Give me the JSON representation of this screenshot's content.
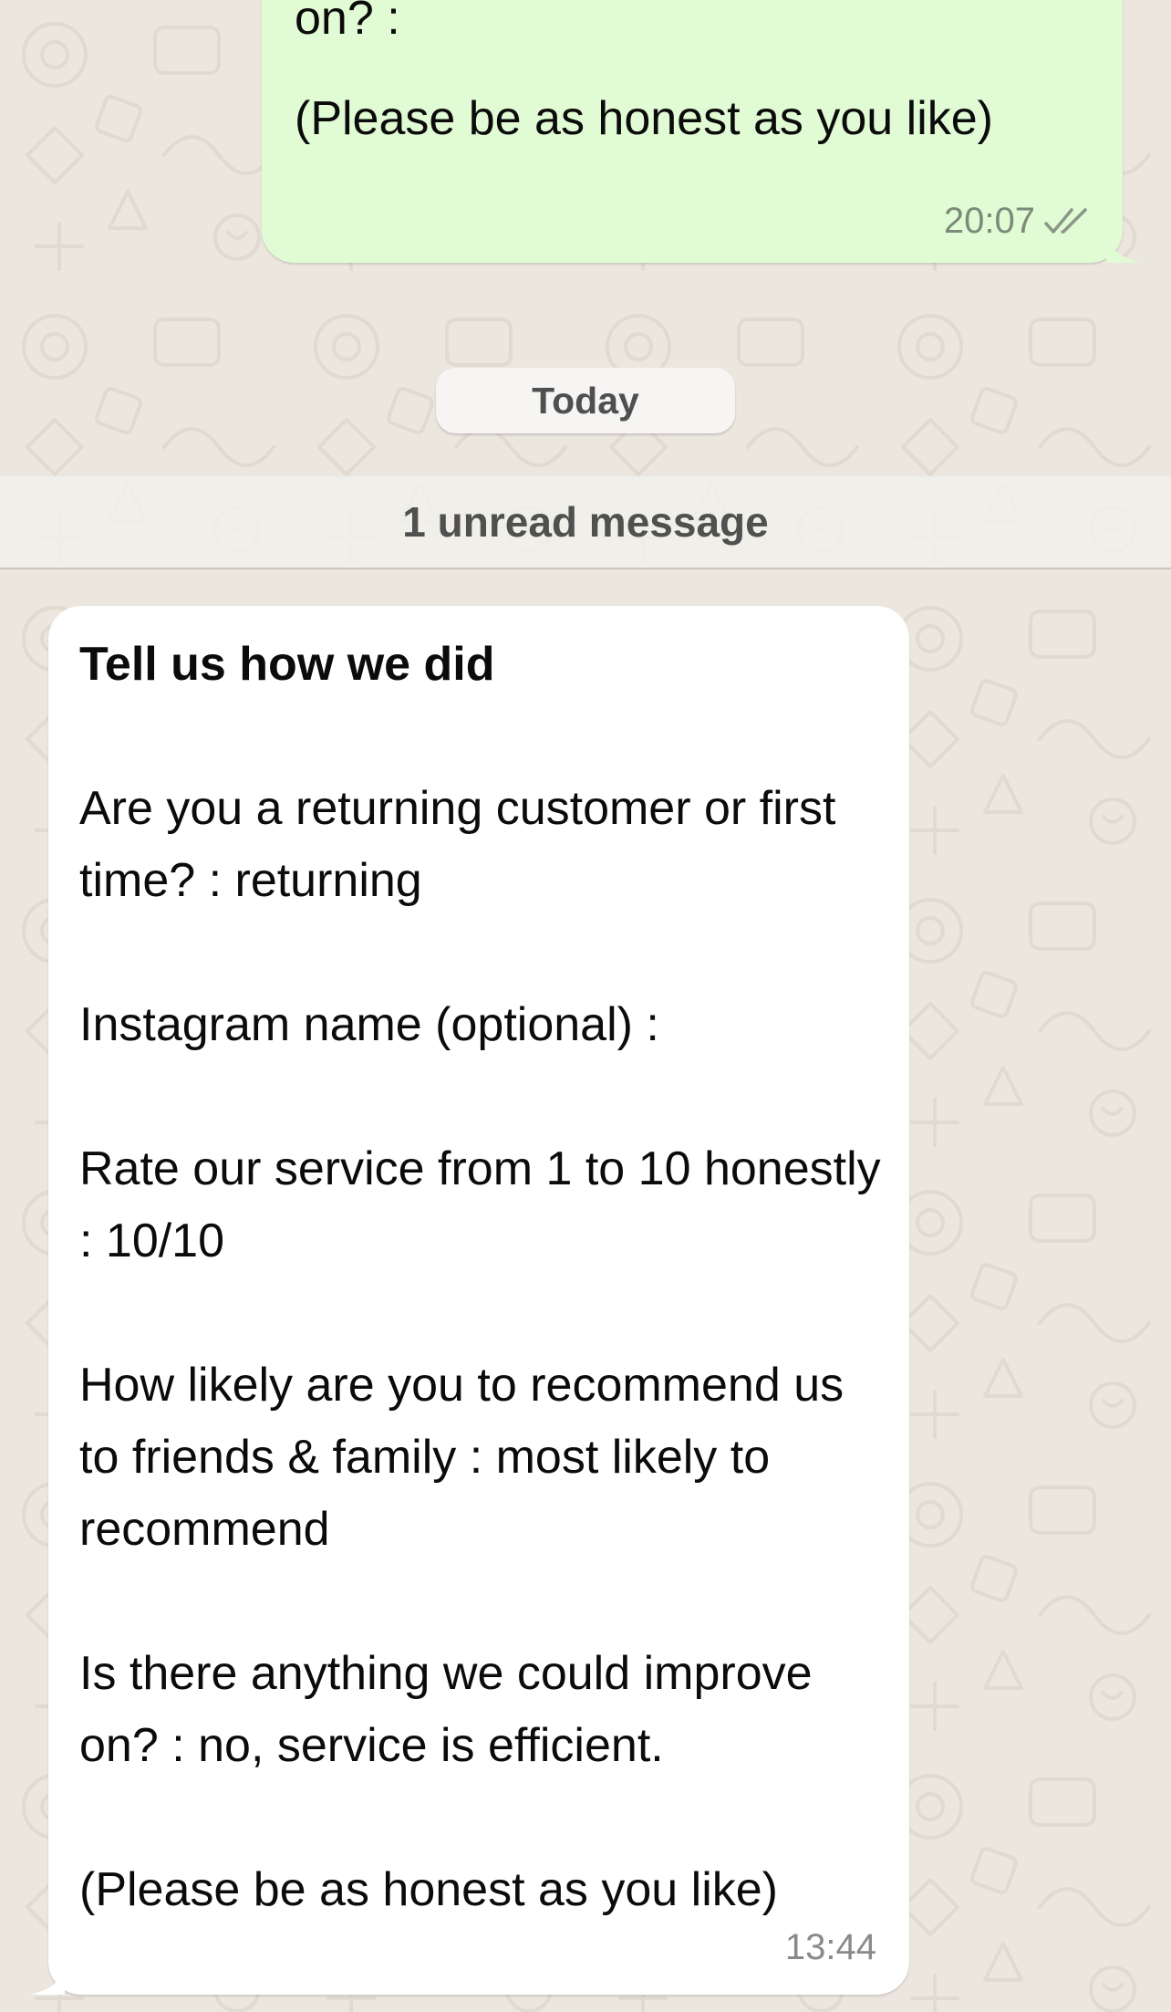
{
  "outgoing_message": {
    "lines": [
      "on? :",
      "(Please be as honest as you like)"
    ],
    "time": "20:07",
    "status_icon": "double-check-icon"
  },
  "date_divider": "Today",
  "unread_divider": "1 unread message",
  "incoming_message": {
    "title": "Tell us how we did",
    "paragraphs": [
      "Are you a returning customer or first time? : returning",
      "Instagram name (optional) :",
      "Rate our service from 1 to 10 honestly : 10/10",
      "How likely are you to recommend us to friends & family : most likely to recommend",
      "Is there anything we could improve on? : no, service is efficient.",
      "(Please be as honest as you like)"
    ],
    "time": "13:44"
  },
  "colors": {
    "background": "#ebe6de",
    "outgoing_bubble": "#e1fbd4",
    "incoming_bubble": "#ffffff"
  }
}
